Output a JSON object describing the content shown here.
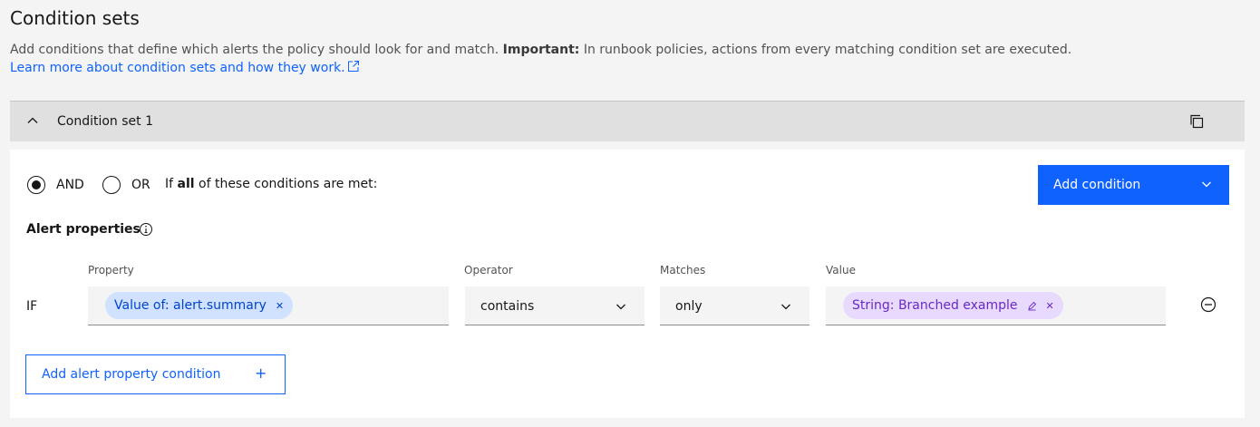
{
  "page": {
    "title": "Condition sets",
    "description": "Add conditions that define which alerts the policy should look for and match.",
    "important_label": "Important:",
    "important_text": "In runbook policies, actions from every matching condition set are executed.",
    "learn_more": "Learn more about condition sets and how they work."
  },
  "condition_set": {
    "name": "Condition set 1",
    "logic": {
      "and_label": "AND",
      "or_label": "OR",
      "selected": "AND",
      "prefix": "If",
      "qualifier": "all",
      "suffix": "of these conditions are met:"
    },
    "add_condition_label": "Add condition",
    "alert_properties_title": "Alert properties",
    "columns": {
      "property": "Property",
      "operator": "Operator",
      "matches": "Matches",
      "value": "Value"
    },
    "row": {
      "if_label": "IF",
      "property_tag": "Value of: alert.summary",
      "operator": "contains",
      "matches": "only",
      "value_tag": "String: Branched example"
    },
    "add_property_label": "Add alert property condition"
  },
  "colors": {
    "primary": "#0f62fe",
    "background": "#f4f4f4",
    "header_bg": "#e0e0e0",
    "tag_blue": "#d0e2ff",
    "tag_purple": "#e8daff"
  }
}
